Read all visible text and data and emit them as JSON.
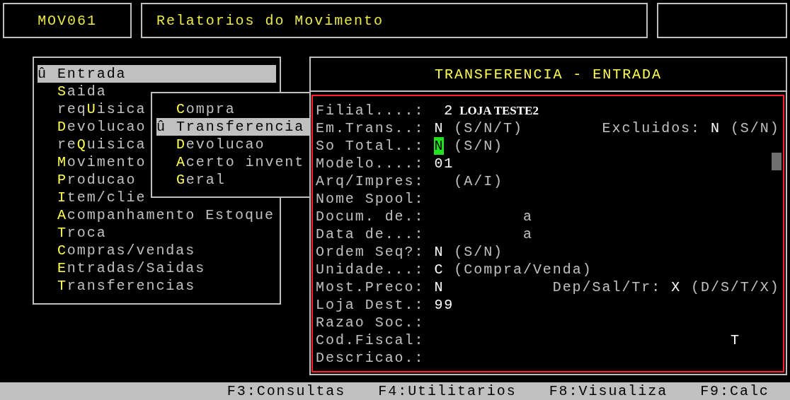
{
  "header": {
    "code": "MOV061",
    "title": "Relatorios do Movimento"
  },
  "menu": {
    "items": [
      {
        "marker": "û",
        "hotkey": "E",
        "rest": "ntrada",
        "selected": true
      },
      {
        "hotkey": "S",
        "rest": "aida",
        "selected": false
      },
      {
        "prefix": "req",
        "hotkey": "U",
        "rest": "isica",
        "selected": false
      },
      {
        "hotkey": "D",
        "rest": "evolucao",
        "selected": false
      },
      {
        "prefix": "re",
        "hotkey": "Q",
        "rest": "uisica",
        "selected": false
      },
      {
        "hotkey": "M",
        "rest": "ovimento",
        "selected": false
      },
      {
        "hotkey": "P",
        "rest": "roducao",
        "selected": false
      },
      {
        "hotkey": "I",
        "rest": "tem/clie",
        "selected": false
      },
      {
        "hotkey": "A",
        "rest": "companhamento Estoque",
        "selected": false
      },
      {
        "hotkey": "T",
        "rest": "roca",
        "selected": false
      },
      {
        "hotkey": "C",
        "rest": "ompras/vendas",
        "selected": false
      },
      {
        "hotkey": "E",
        "rest": "ntradas/Saidas",
        "selected": false
      },
      {
        "hotkey": "T",
        "rest": "ransferencias",
        "selected": false
      }
    ]
  },
  "submenu": {
    "items": [
      {
        "hotkey": "C",
        "rest": "ompra",
        "selected": false
      },
      {
        "marker": "û",
        "hotkey": "T",
        "rest": "ransferencia",
        "selected": true
      },
      {
        "hotkey": "D",
        "rest": "evolucao",
        "selected": false
      },
      {
        "hotkey": "A",
        "rest": "certo invent",
        "selected": false
      },
      {
        "hotkey": "G",
        "rest": "eral",
        "selected": false
      }
    ]
  },
  "form": {
    "title": "TRANSFERENCIA - ENTRADA",
    "fields": [
      {
        "kind": "store",
        "label": "Filial....:",
        "value": "2",
        "cursor": false,
        "name": "LOJA TESTE2"
      },
      {
        "kind": "option",
        "label": "Em.Trans..:",
        "value": "N",
        "cursor": false,
        "hint": "(S/N/T)",
        "side": {
          "label": "Excluidos:",
          "value": "N",
          "hint": "(S/N)"
        }
      },
      {
        "kind": "option",
        "label": "So Total..:",
        "value": "N",
        "cursor": true,
        "hint": "(S/N)"
      },
      {
        "kind": "option",
        "label": "Modelo....:",
        "value": "01",
        "cursor": false
      },
      {
        "kind": "option",
        "label": "Arq/Impres:",
        "hint": "(A/I)"
      },
      {
        "kind": "option",
        "label": "Nome Spool:"
      },
      {
        "kind": "range",
        "label": "Docum. de.:",
        "separator": "a"
      },
      {
        "kind": "range",
        "label": "Data de...:",
        "separator": "a"
      },
      {
        "kind": "option",
        "label": "Ordem Seq?:",
        "value": "N",
        "cursor": false,
        "hint": "(S/N)"
      },
      {
        "kind": "option",
        "label": "Unidade...:",
        "value": "C",
        "cursor": false,
        "hint": "(Compra/Venda)"
      },
      {
        "kind": "option",
        "label": "Most.Preco:",
        "value": "N",
        "cursor": false,
        "side": {
          "label": "Dep/Sal/Tr:",
          "value": "X",
          "hint": "(D/S/T/X)"
        }
      },
      {
        "kind": "option",
        "label": "Loja Dest.:",
        "value": "99",
        "cursor": false
      },
      {
        "kind": "option",
        "label": "Razao Soc.:"
      },
      {
        "kind": "fiscal",
        "label": "Cod.Fiscal:",
        "flag": "T"
      },
      {
        "kind": "option",
        "label": "Descricao.:"
      }
    ]
  },
  "function_keys": [
    "F3:Consultas",
    "F4:Utilitarios",
    "F8:Visualiza",
    "F9:Calc"
  ]
}
